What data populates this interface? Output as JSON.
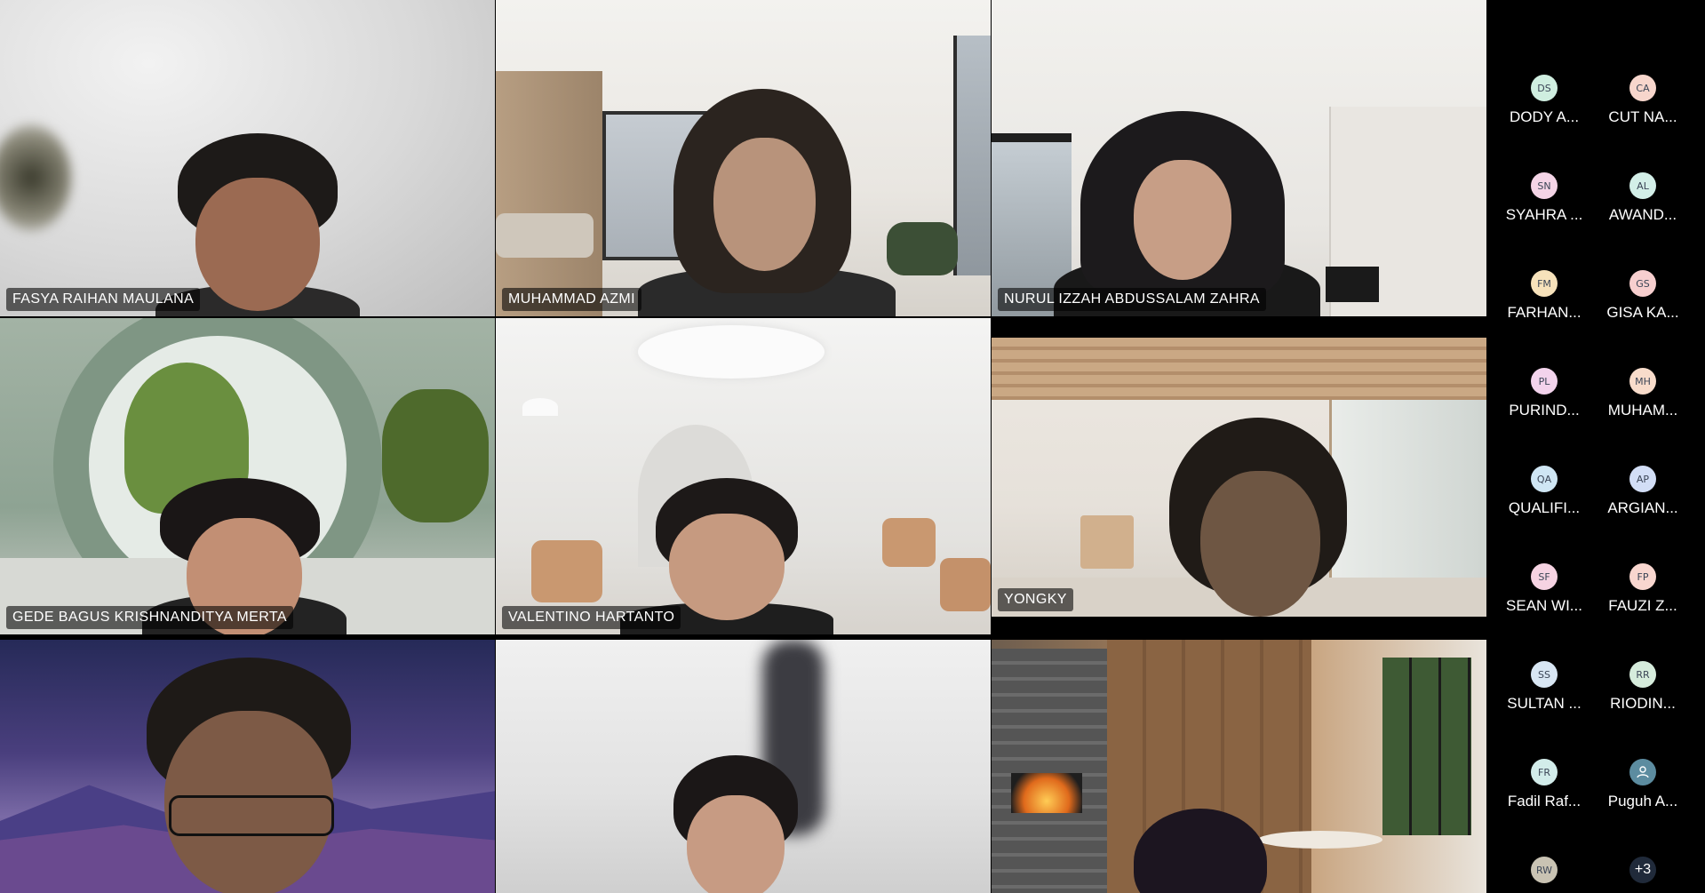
{
  "tiles": [
    {
      "name": "FASYA RAIHAN MAULANA"
    },
    {
      "name": "MUHAMMAD AZMI"
    },
    {
      "name": "NURUL IZZAH ABDUSSALAM ZAHRA"
    },
    {
      "name": "GEDE BAGUS KRISHNANDITYA MERTA"
    },
    {
      "name": "VALENTINO HARTANTO"
    },
    {
      "name": "YONGKY"
    },
    {
      "name": ""
    },
    {
      "name": ""
    },
    {
      "name": ""
    }
  ],
  "participants": [
    {
      "initials": "DS",
      "name": "DODY A...",
      "color": "#cfeee0"
    },
    {
      "initials": "CA",
      "name": "CUT NA...",
      "color": "#f7d6cc"
    },
    {
      "initials": "SN",
      "name": "SYAHRA ...",
      "color": "#f4d4e6"
    },
    {
      "initials": "AL",
      "name": "AWAND...",
      "color": "#d3efe8"
    },
    {
      "initials": "FM",
      "name": "FARHAN...",
      "color": "#f7e2bb"
    },
    {
      "initials": "GS",
      "name": "GISA KA...",
      "color": "#f7cfcf"
    },
    {
      "initials": "PL",
      "name": "PURIND...",
      "color": "#f3d3ec"
    },
    {
      "initials": "MH",
      "name": "MUHAM...",
      "color": "#f8dccb"
    },
    {
      "initials": "QA",
      "name": "QUALIFI...",
      "color": "#cfe6f4"
    },
    {
      "initials": "AP",
      "name": "ARGIAN...",
      "color": "#d2def6"
    },
    {
      "initials": "SF",
      "name": "SEAN WI...",
      "color": "#f6d3e2"
    },
    {
      "initials": "FP",
      "name": "FAUZI Z...",
      "color": "#f8d6cf"
    },
    {
      "initials": "SS",
      "name": "SULTAN ...",
      "color": "#d8e6f3"
    },
    {
      "initials": "RR",
      "name": "RIODIN...",
      "color": "#d6ecdc"
    },
    {
      "initials": "FR",
      "name": "Fadil Raf...",
      "color": "#d2ecea"
    },
    {
      "initials": "",
      "name": "Puguh A...",
      "color": "#5c8ca0"
    },
    {
      "initials": "RW",
      "name": "",
      "color": "#c9c3b3"
    }
  ],
  "overflow_count": "+3"
}
